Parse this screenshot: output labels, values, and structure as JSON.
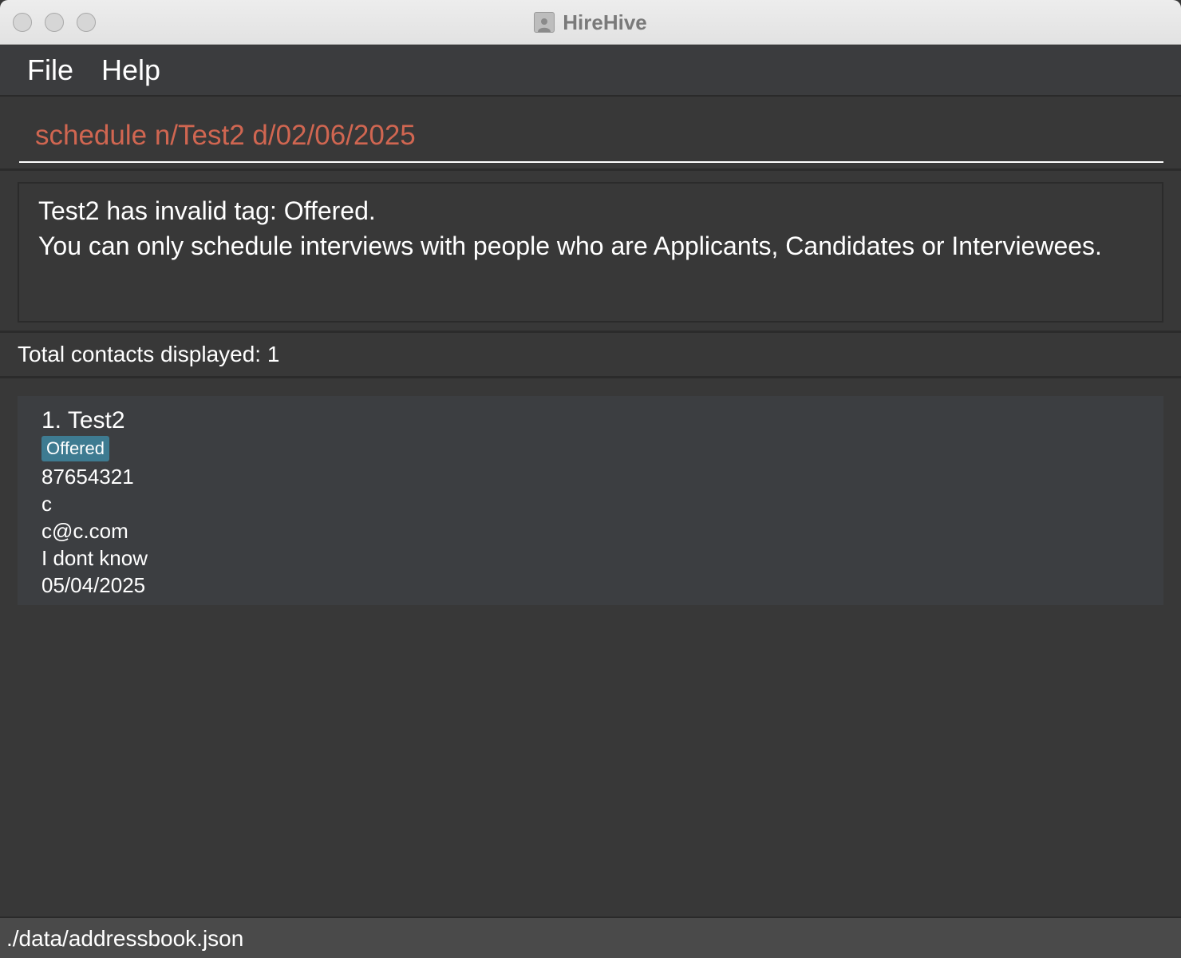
{
  "window": {
    "title": "HireHive",
    "app_icon": "contacts-app-icon"
  },
  "menu": {
    "file_label": "File",
    "help_label": "Help"
  },
  "command_box": {
    "value": "schedule n/Test2 d/02/06/2025"
  },
  "result": {
    "line1": "Test2 has invalid tag: Offered.",
    "line2": "You can only schedule interviews with people who are Applicants, Candidates or Interviewees."
  },
  "list": {
    "header": "Total contacts displayed: 1",
    "contacts": [
      {
        "index_name": "1. Test2",
        "tag": "Offered",
        "phone": "87654321",
        "address": "c",
        "email": "c@c.com",
        "note": "I dont know",
        "date": "05/04/2025"
      }
    ]
  },
  "status_bar": {
    "path": "./data/addressbook.json"
  },
  "colors": {
    "background": "#383838",
    "command_text": "#d06651",
    "tag_background": "#3e7b91",
    "card_background": "#3c3e41"
  }
}
